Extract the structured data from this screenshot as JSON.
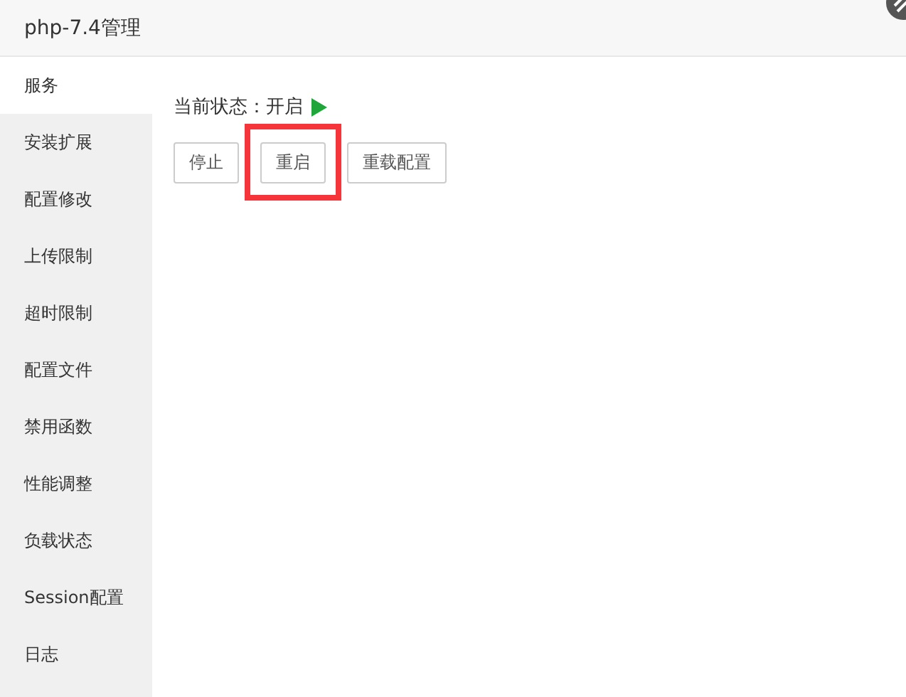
{
  "window": {
    "title": "php-7.4管理"
  },
  "sidebar": {
    "items": [
      {
        "label": "服务",
        "selected": true
      },
      {
        "label": "安装扩展",
        "selected": false
      },
      {
        "label": "配置修改",
        "selected": false
      },
      {
        "label": "上传限制",
        "selected": false
      },
      {
        "label": "超时限制",
        "selected": false
      },
      {
        "label": "配置文件",
        "selected": false
      },
      {
        "label": "禁用函数",
        "selected": false
      },
      {
        "label": "性能调整",
        "selected": false
      },
      {
        "label": "负载状态",
        "selected": false
      },
      {
        "label": "Session配置",
        "selected": false
      },
      {
        "label": "日志",
        "selected": false
      }
    ]
  },
  "status": {
    "label": "当前状态：开启",
    "on": true
  },
  "buttons": [
    {
      "label": "停止",
      "highlighted": false
    },
    {
      "label": "重启",
      "highlighted": true
    },
    {
      "label": "重载配置",
      "highlighted": false
    }
  ]
}
